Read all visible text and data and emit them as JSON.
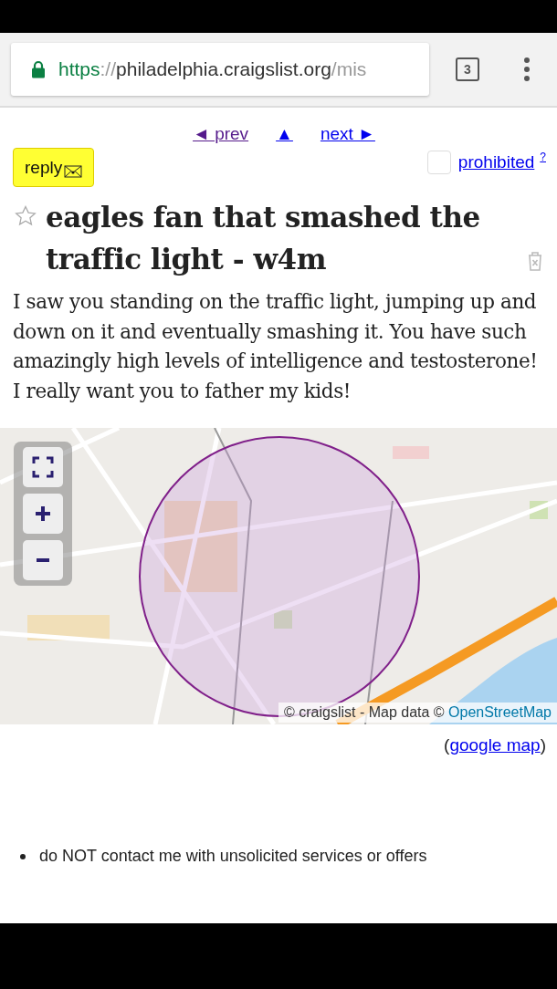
{
  "browser": {
    "url_scheme": "https",
    "url_separator": "://",
    "url_host": "philadelphia.craigslist.org",
    "url_path": "/mis",
    "tab_count": "3"
  },
  "nav": [
    {
      "label": "◄ prev",
      "visited": true
    },
    {
      "label": "▲",
      "visited": false
    },
    {
      "label": "next ►",
      "visited": false
    }
  ],
  "reply_button": "reply",
  "flag": {
    "label": "prohibited",
    "help": "?",
    "checked": false
  },
  "post": {
    "title": "eagles fan that smashed the traffic light - w4m",
    "favorited": false,
    "body": "I saw you standing on the traffic light, jumping up and down on it and eventually smashing it. You have such amazingly high levels of intelligence and testosterone! I really want you to father my kids!"
  },
  "map": {
    "kind": "picture",
    "controls": [
      {
        "kind": "fullscreen"
      },
      {
        "kind": "zoom-in"
      },
      {
        "kind": "zoom-out"
      }
    ],
    "attribution": "© craigslist - Map data © ",
    "attribution_link": "OpenStreetMap"
  },
  "map_link": {
    "open": "(",
    "link": "google map",
    "close": ")"
  },
  "notices": [
    "do NOT contact me with unsolicited services or offers"
  ]
}
